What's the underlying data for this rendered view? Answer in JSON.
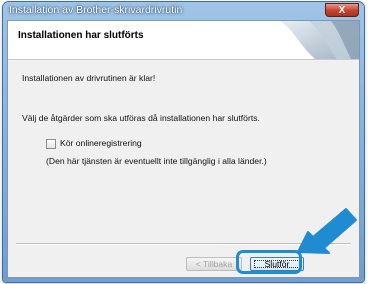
{
  "window": {
    "title": "Installation av Brother-skrivardrivrutin",
    "close_label": "X"
  },
  "header": {
    "title": "Installationen har slutförts"
  },
  "main": {
    "completed_message": "Installationen av drivrutinen är klar!",
    "instruction": "Välj de åtgärder som ska utföras då installationen har slutförts.",
    "registration_checkbox": {
      "label": "Kör onlineregistrering",
      "checked": false
    },
    "availability_note": "(Den här tjänsten är eventuellt inte tillgänglig i alla länder.)"
  },
  "buttons": {
    "back_label": "< Tillbaka",
    "finish_label": "Slutför"
  },
  "colors": {
    "annotation_blue": "#1f8bd1"
  }
}
